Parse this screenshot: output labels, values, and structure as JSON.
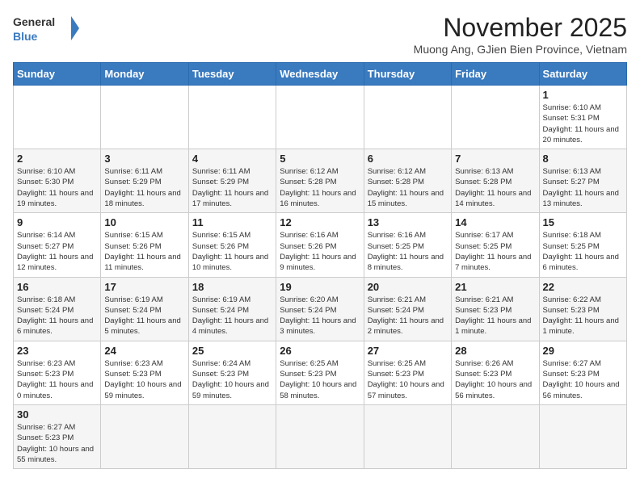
{
  "header": {
    "logo_general": "General",
    "logo_blue": "Blue",
    "month_title": "November 2025",
    "location": "Muong Ang, GJien Bien Province, Vietnam"
  },
  "days_of_week": [
    "Sunday",
    "Monday",
    "Tuesday",
    "Wednesday",
    "Thursday",
    "Friday",
    "Saturday"
  ],
  "weeks": [
    {
      "cells": [
        {
          "day": null,
          "info": null
        },
        {
          "day": null,
          "info": null
        },
        {
          "day": null,
          "info": null
        },
        {
          "day": null,
          "info": null
        },
        {
          "day": null,
          "info": null
        },
        {
          "day": null,
          "info": null
        },
        {
          "day": "1",
          "info": "Sunrise: 6:10 AM\nSunset: 5:31 PM\nDaylight: 11 hours\nand 20 minutes."
        }
      ]
    },
    {
      "cells": [
        {
          "day": "2",
          "info": "Sunrise: 6:10 AM\nSunset: 5:30 PM\nDaylight: 11 hours\nand 19 minutes."
        },
        {
          "day": "3",
          "info": "Sunrise: 6:11 AM\nSunset: 5:29 PM\nDaylight: 11 hours\nand 18 minutes."
        },
        {
          "day": "4",
          "info": "Sunrise: 6:11 AM\nSunset: 5:29 PM\nDaylight: 11 hours\nand 17 minutes."
        },
        {
          "day": "5",
          "info": "Sunrise: 6:12 AM\nSunset: 5:28 PM\nDaylight: 11 hours\nand 16 minutes."
        },
        {
          "day": "6",
          "info": "Sunrise: 6:12 AM\nSunset: 5:28 PM\nDaylight: 11 hours\nand 15 minutes."
        },
        {
          "day": "7",
          "info": "Sunrise: 6:13 AM\nSunset: 5:28 PM\nDaylight: 11 hours\nand 14 minutes."
        },
        {
          "day": "8",
          "info": "Sunrise: 6:13 AM\nSunset: 5:27 PM\nDaylight: 11 hours\nand 13 minutes."
        }
      ]
    },
    {
      "cells": [
        {
          "day": "9",
          "info": "Sunrise: 6:14 AM\nSunset: 5:27 PM\nDaylight: 11 hours\nand 12 minutes."
        },
        {
          "day": "10",
          "info": "Sunrise: 6:15 AM\nSunset: 5:26 PM\nDaylight: 11 hours\nand 11 minutes."
        },
        {
          "day": "11",
          "info": "Sunrise: 6:15 AM\nSunset: 5:26 PM\nDaylight: 11 hours\nand 10 minutes."
        },
        {
          "day": "12",
          "info": "Sunrise: 6:16 AM\nSunset: 5:26 PM\nDaylight: 11 hours\nand 9 minutes."
        },
        {
          "day": "13",
          "info": "Sunrise: 6:16 AM\nSunset: 5:25 PM\nDaylight: 11 hours\nand 8 minutes."
        },
        {
          "day": "14",
          "info": "Sunrise: 6:17 AM\nSunset: 5:25 PM\nDaylight: 11 hours\nand 7 minutes."
        },
        {
          "day": "15",
          "info": "Sunrise: 6:18 AM\nSunset: 5:25 PM\nDaylight: 11 hours\nand 6 minutes."
        }
      ]
    },
    {
      "cells": [
        {
          "day": "16",
          "info": "Sunrise: 6:18 AM\nSunset: 5:24 PM\nDaylight: 11 hours\nand 6 minutes."
        },
        {
          "day": "17",
          "info": "Sunrise: 6:19 AM\nSunset: 5:24 PM\nDaylight: 11 hours\nand 5 minutes."
        },
        {
          "day": "18",
          "info": "Sunrise: 6:19 AM\nSunset: 5:24 PM\nDaylight: 11 hours\nand 4 minutes."
        },
        {
          "day": "19",
          "info": "Sunrise: 6:20 AM\nSunset: 5:24 PM\nDaylight: 11 hours\nand 3 minutes."
        },
        {
          "day": "20",
          "info": "Sunrise: 6:21 AM\nSunset: 5:24 PM\nDaylight: 11 hours\nand 2 minutes."
        },
        {
          "day": "21",
          "info": "Sunrise: 6:21 AM\nSunset: 5:23 PM\nDaylight: 11 hours\nand 1 minute."
        },
        {
          "day": "22",
          "info": "Sunrise: 6:22 AM\nSunset: 5:23 PM\nDaylight: 11 hours\nand 1 minute."
        }
      ]
    },
    {
      "cells": [
        {
          "day": "23",
          "info": "Sunrise: 6:23 AM\nSunset: 5:23 PM\nDaylight: 11 hours\nand 0 minutes."
        },
        {
          "day": "24",
          "info": "Sunrise: 6:23 AM\nSunset: 5:23 PM\nDaylight: 10 hours\nand 59 minutes."
        },
        {
          "day": "25",
          "info": "Sunrise: 6:24 AM\nSunset: 5:23 PM\nDaylight: 10 hours\nand 59 minutes."
        },
        {
          "day": "26",
          "info": "Sunrise: 6:25 AM\nSunset: 5:23 PM\nDaylight: 10 hours\nand 58 minutes."
        },
        {
          "day": "27",
          "info": "Sunrise: 6:25 AM\nSunset: 5:23 PM\nDaylight: 10 hours\nand 57 minutes."
        },
        {
          "day": "28",
          "info": "Sunrise: 6:26 AM\nSunset: 5:23 PM\nDaylight: 10 hours\nand 56 minutes."
        },
        {
          "day": "29",
          "info": "Sunrise: 6:27 AM\nSunset: 5:23 PM\nDaylight: 10 hours\nand 56 minutes."
        }
      ]
    },
    {
      "cells": [
        {
          "day": "30",
          "info": "Sunrise: 6:27 AM\nSunset: 5:23 PM\nDaylight: 10 hours\nand 55 minutes."
        },
        {
          "day": null,
          "info": null
        },
        {
          "day": null,
          "info": null
        },
        {
          "day": null,
          "info": null
        },
        {
          "day": null,
          "info": null
        },
        {
          "day": null,
          "info": null
        },
        {
          "day": null,
          "info": null
        }
      ]
    }
  ]
}
